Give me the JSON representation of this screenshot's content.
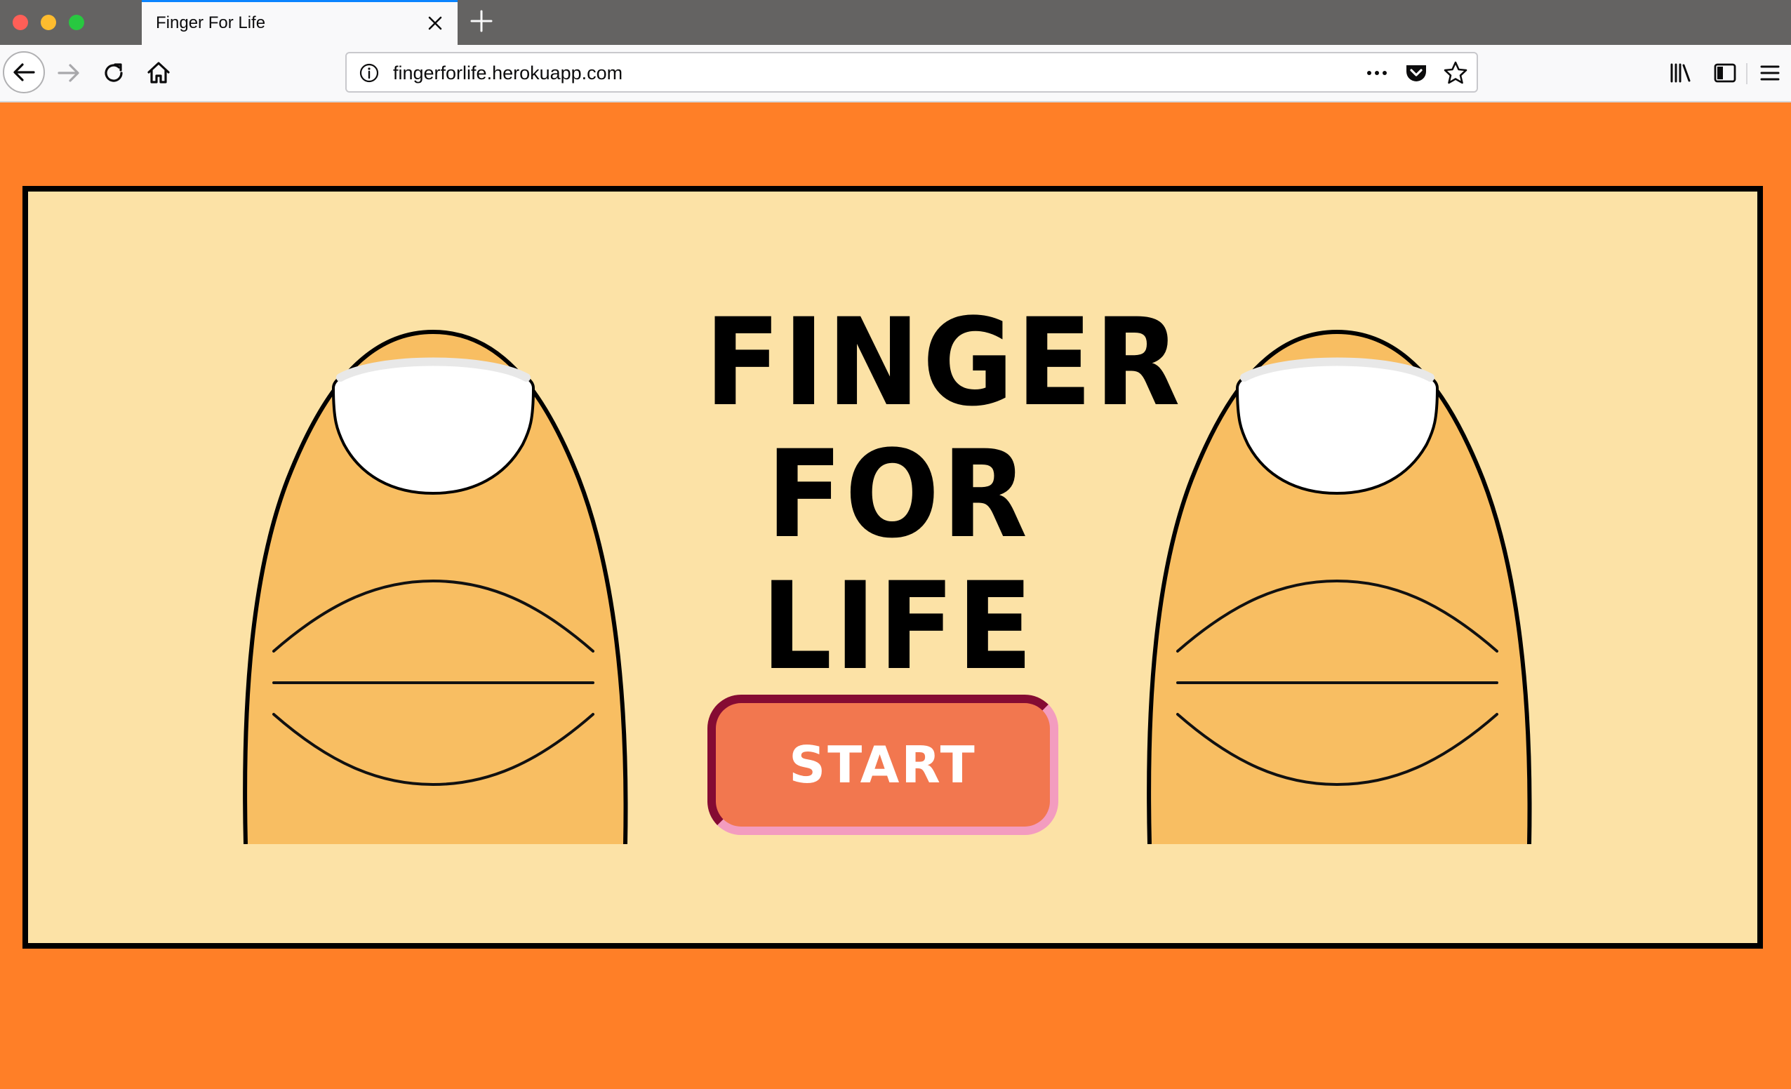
{
  "browser": {
    "tab": {
      "title": "Finger For Life"
    },
    "url": "fingerforlife.herokuapp.com"
  },
  "icons": {
    "window_controls": [
      "close-dot",
      "minimize-dot",
      "zoom-dot"
    ],
    "tabbar": [
      "close-icon",
      "plus-icon"
    ],
    "navbar": [
      "back-arrow-icon",
      "forward-arrow-icon",
      "reload-icon",
      "home-icon",
      "info-icon",
      "more-dots-icon",
      "pocket-icon",
      "star-icon",
      "library-icon",
      "sidebar-icon",
      "hamburger-menu-icon"
    ]
  },
  "game": {
    "title_lines": [
      "FINGER",
      "FOR",
      "LIFE"
    ],
    "start_label": "START"
  },
  "colors": {
    "page_background": "#ff7f27",
    "frame_background": "#fce2a6",
    "finger_skin": "#f8be62",
    "nail": "#ffffff",
    "button_fill": "#f2774f",
    "button_border_dark": "#850b33",
    "button_border_light": "#f39cbf"
  }
}
